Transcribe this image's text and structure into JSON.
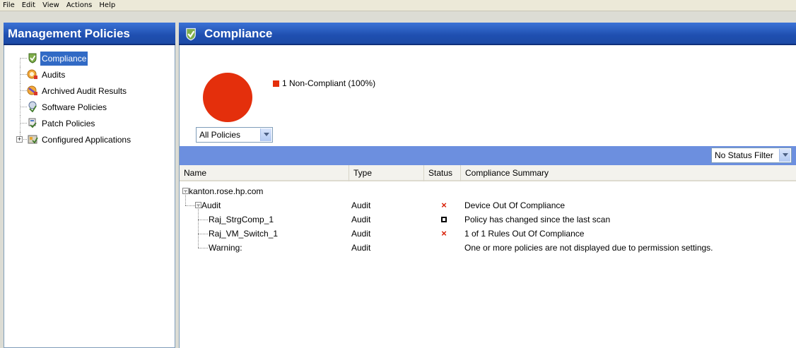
{
  "menu": [
    "File",
    "Edit",
    "View",
    "Actions",
    "Help"
  ],
  "left_panel": {
    "title": "Management Policies",
    "tree": [
      {
        "label": "Compliance",
        "icon": "compliance-icon",
        "selected": true
      },
      {
        "label": "Audits",
        "icon": "audits-icon"
      },
      {
        "label": "Archived Audit Results",
        "icon": "archived-audit-icon"
      },
      {
        "label": "Software Policies",
        "icon": "software-policies-icon"
      },
      {
        "label": "Patch Policies",
        "icon": "patch-policies-icon"
      },
      {
        "label": "Configured Applications",
        "icon": "configured-applications-icon",
        "expandable": true
      }
    ]
  },
  "main": {
    "title": "Compliance",
    "chart_legend": "1 Non-Compliant (100%)",
    "policy_filter": "All Policies",
    "status_filter": "No Status Filter",
    "columns": [
      "Name",
      "Type",
      "Status",
      "Compliance Summary"
    ],
    "rows": [
      {
        "name": "kanton.rose.hp.com",
        "type": "",
        "status": "",
        "summary": ""
      },
      {
        "name": "Audit",
        "type": "Audit",
        "status": "×",
        "summary": "Device Out Of Compliance"
      },
      {
        "name": "Raj_StrgComp_1",
        "type": "Audit",
        "status": "box",
        "summary": "Policy has changed since the last scan"
      },
      {
        "name": "Raj_VM_Switch_1",
        "type": "Audit",
        "status": "×",
        "summary": "1 of 1 Rules Out Of Compliance"
      },
      {
        "name": "Warning:",
        "type": "Audit",
        "status": "",
        "summary": "One or more policies are not displayed due to permission settings."
      }
    ]
  },
  "colors": {
    "header_blue": "#1f4fb0",
    "non_compliant": "#e42f0c",
    "filter_bar": "#6c8fdf",
    "selection": "#316ac5"
  }
}
